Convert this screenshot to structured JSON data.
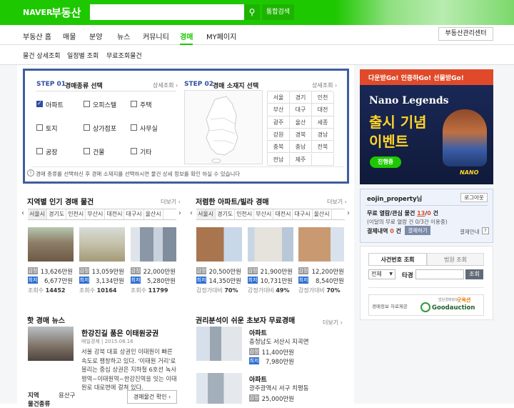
{
  "header": {
    "logo_naver": "NAVER",
    "logo_service": "부동산",
    "search_placeholder": "",
    "search_button": "통합검색"
  },
  "gnb": {
    "items": [
      "부동산 홈",
      "매물",
      "분양",
      "뉴스",
      "커뮤니티",
      "경매",
      "MY페이지"
    ],
    "active": "경매",
    "manager_button": "부동산관리센터"
  },
  "subnav": {
    "items": [
      "물건 상세조회",
      "일정별 조회",
      "무료조회물건"
    ]
  },
  "step1": {
    "label": "STEP 01",
    "title": "경매종류 선택",
    "detail": "상세조회 ›",
    "options": [
      [
        "아파트",
        "오피스텔",
        "주택"
      ],
      [
        "토지",
        "상가점포",
        "사무실"
      ],
      [
        "공장",
        "건물",
        "기타"
      ]
    ],
    "checked": "아파트"
  },
  "step2": {
    "label": "STEP 02",
    "title": "경매 소재지 선택",
    "detail": "상세조회 ›",
    "regions": [
      [
        "서울",
        "경기",
        "인천"
      ],
      [
        "부산",
        "대구",
        "대전"
      ],
      [
        "광주",
        "울산",
        "세종"
      ],
      [
        "강원",
        "경북",
        "경남"
      ],
      [
        "충북",
        "충남",
        "전북"
      ],
      [
        "전남",
        "제주",
        ""
      ]
    ]
  },
  "notice": "경매 종류를 선택하신 후 경매 소재지를 선택하시면 물건 상세 정보를 확인 하실 수 있습니다",
  "popular": {
    "title": "지역별 인기 경매 물건",
    "more": "더보기 ›",
    "tabs": [
      "서울시",
      "경기도",
      "인천시",
      "부산시",
      "대전시",
      "대구시",
      "울산시"
    ],
    "items": [
      {
        "appraised": "13,626만원",
        "lowest": "6,677만원",
        "views_label": "조회수",
        "views": "14452"
      },
      {
        "appraised": "13,059만원",
        "lowest": "3,134만원",
        "views_label": "조회수",
        "views": "10164"
      },
      {
        "appraised": "22,000만원",
        "lowest": "5,280만원",
        "views_label": "조회수",
        "views": "11799"
      }
    ]
  },
  "cheap": {
    "title": "저렴한 아파트/빌라 경매",
    "more": "더보기 ›",
    "tabs": [
      "서울시",
      "경기도",
      "인천시",
      "부산시",
      "대전시",
      "대구시",
      "울산시"
    ],
    "items": [
      {
        "appraised": "20,500만원",
        "lowest": "14,350만원",
        "rate_label": "감정가대비",
        "rate": "70%"
      },
      {
        "appraised": "21,900만원",
        "lowest": "10,731만원",
        "rate_label": "감정가대비",
        "rate": "49%"
      },
      {
        "appraised": "12,200만원",
        "lowest": "8,540만원",
        "rate_label": "감정가대비",
        "rate": "70%"
      }
    ]
  },
  "tags": {
    "appraised": "감정",
    "lowest": "최저"
  },
  "news": {
    "title": "핫 경매 뉴스",
    "headline": "한강진길 품은 이태원궁권",
    "source": "매일경제",
    "date": "2015.08.16",
    "body": "서울 강북 대표 상권인 이태원이 빠른 속도로 팽창하고 있다. '이태원 거리'로 불리는 중심 상권은 지하철 6호선 녹사평역~이태원역~한강진역을 잇는 이태원로 대로변에 걸쳐 있다.",
    "region_label": "지역",
    "region_value": "용산구",
    "kind_label": "물건종류",
    "confirm_button": "경매물건 확인 ›"
  },
  "beginner": {
    "title": "권리분석이 쉬운 초보자 무료경매",
    "more": "더보기 ›",
    "items": [
      {
        "type": "아파트",
        "addr": "충청남도 서산시 지곡면",
        "appraised": "11,400만원",
        "lowest": "7,980만원"
      },
      {
        "type": "아파트",
        "addr": "광주광역시 서구 치평동",
        "appraised": "25,000만원"
      }
    ]
  },
  "ad": {
    "top": "다운받Go! 인증하Go! 선물받Go!",
    "game": "Nano Legends",
    "line1": "출시 기념",
    "line2": "이벤트",
    "button": "진행중",
    "brand": "NANO"
  },
  "user": {
    "name": "eojin_property님",
    "logout": "로그아웃",
    "free_label": "무료 열람/관심 물건",
    "used": "13",
    "total": "0",
    "unit": "건",
    "sub": "(이달의 무료 열람 건 0/3건 이용중)",
    "pay_label": "결제내역",
    "pay_count": "0",
    "pay_unit": "건",
    "pay_button": "결제하기",
    "pay_guide": "결제안내",
    "help": "?"
  },
  "case_search": {
    "tab1": "사건번호 조회",
    "tab2": "법원 조회",
    "select": "전체",
    "label": "타경",
    "button": "조회"
  },
  "provider": {
    "label": "경매정보 자료제공",
    "brand_small": "법원경매정보",
    "brand": "굿옥션",
    "brand_en": "Goodauction"
  },
  "colors": {
    "naver_green": "#1ec800",
    "step_blue": "#2c4da0",
    "lowest_blue": "#2c6fd1"
  }
}
